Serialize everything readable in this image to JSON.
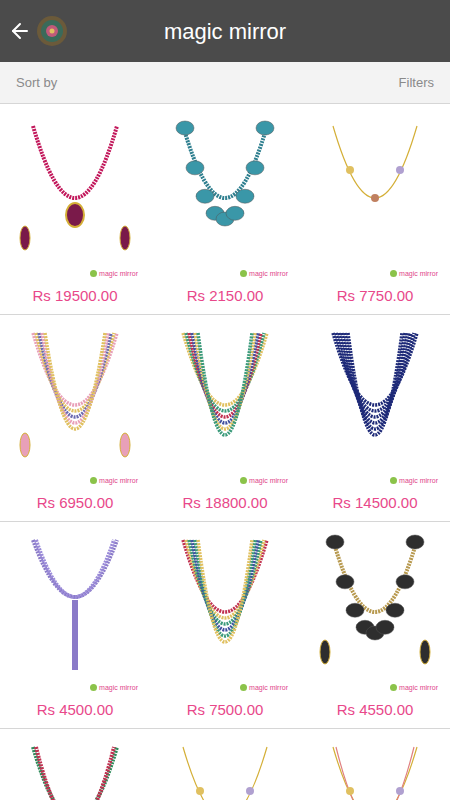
{
  "header": {
    "title": "magic mirror"
  },
  "toolbar": {
    "sort": "Sort by",
    "filters": "Filters"
  },
  "products": [
    {
      "price": "Rs 19500.00",
      "brand": "magic mirror"
    },
    {
      "price": "Rs 2150.00",
      "brand": "magic mirror"
    },
    {
      "price": "Rs 7750.00",
      "brand": "magic mirror"
    },
    {
      "price": "Rs 6950.00",
      "brand": "magic mirror"
    },
    {
      "price": "Rs 18800.00",
      "brand": "magic mirror"
    },
    {
      "price": "Rs 14500.00",
      "brand": "magic mirror"
    },
    {
      "price": "Rs 4500.00",
      "brand": "magic mirror"
    },
    {
      "price": "Rs 7500.00",
      "brand": "magic mirror"
    },
    {
      "price": "Rs 4550.00",
      "brand": "magic mirror"
    },
    {
      "price": null,
      "brand": null
    },
    {
      "price": null,
      "brand": null
    },
    {
      "price": null,
      "brand": null
    }
  ]
}
